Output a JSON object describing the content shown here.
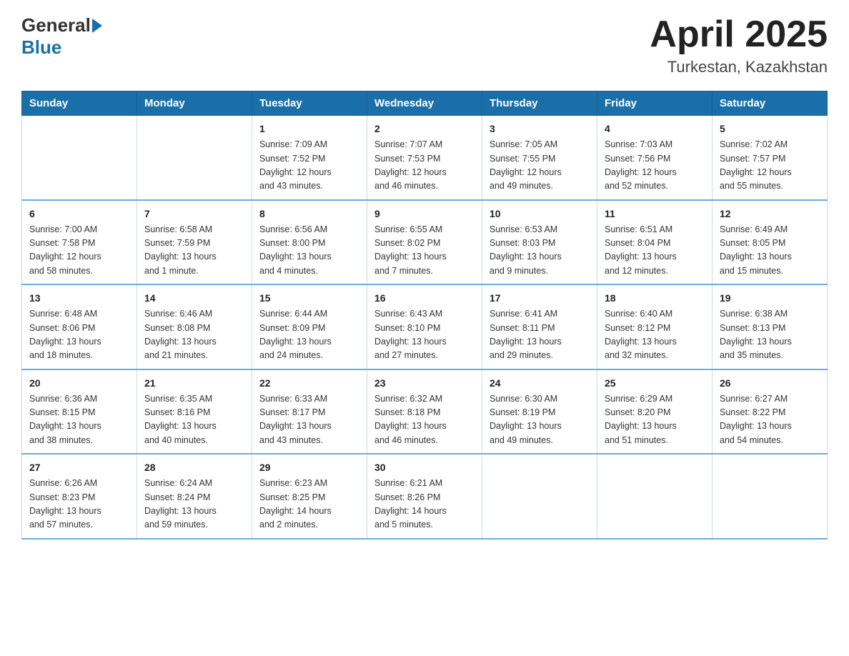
{
  "header": {
    "logo_general": "General",
    "logo_blue": "Blue",
    "title": "April 2025",
    "subtitle": "Turkestan, Kazakhstan"
  },
  "weekdays": [
    "Sunday",
    "Monday",
    "Tuesday",
    "Wednesday",
    "Thursday",
    "Friday",
    "Saturday"
  ],
  "weeks": [
    [
      {
        "day": "",
        "info": ""
      },
      {
        "day": "",
        "info": ""
      },
      {
        "day": "1",
        "info": "Sunrise: 7:09 AM\nSunset: 7:52 PM\nDaylight: 12 hours\nand 43 minutes."
      },
      {
        "day": "2",
        "info": "Sunrise: 7:07 AM\nSunset: 7:53 PM\nDaylight: 12 hours\nand 46 minutes."
      },
      {
        "day": "3",
        "info": "Sunrise: 7:05 AM\nSunset: 7:55 PM\nDaylight: 12 hours\nand 49 minutes."
      },
      {
        "day": "4",
        "info": "Sunrise: 7:03 AM\nSunset: 7:56 PM\nDaylight: 12 hours\nand 52 minutes."
      },
      {
        "day": "5",
        "info": "Sunrise: 7:02 AM\nSunset: 7:57 PM\nDaylight: 12 hours\nand 55 minutes."
      }
    ],
    [
      {
        "day": "6",
        "info": "Sunrise: 7:00 AM\nSunset: 7:58 PM\nDaylight: 12 hours\nand 58 minutes."
      },
      {
        "day": "7",
        "info": "Sunrise: 6:58 AM\nSunset: 7:59 PM\nDaylight: 13 hours\nand 1 minute."
      },
      {
        "day": "8",
        "info": "Sunrise: 6:56 AM\nSunset: 8:00 PM\nDaylight: 13 hours\nand 4 minutes."
      },
      {
        "day": "9",
        "info": "Sunrise: 6:55 AM\nSunset: 8:02 PM\nDaylight: 13 hours\nand 7 minutes."
      },
      {
        "day": "10",
        "info": "Sunrise: 6:53 AM\nSunset: 8:03 PM\nDaylight: 13 hours\nand 9 minutes."
      },
      {
        "day": "11",
        "info": "Sunrise: 6:51 AM\nSunset: 8:04 PM\nDaylight: 13 hours\nand 12 minutes."
      },
      {
        "day": "12",
        "info": "Sunrise: 6:49 AM\nSunset: 8:05 PM\nDaylight: 13 hours\nand 15 minutes."
      }
    ],
    [
      {
        "day": "13",
        "info": "Sunrise: 6:48 AM\nSunset: 8:06 PM\nDaylight: 13 hours\nand 18 minutes."
      },
      {
        "day": "14",
        "info": "Sunrise: 6:46 AM\nSunset: 8:08 PM\nDaylight: 13 hours\nand 21 minutes."
      },
      {
        "day": "15",
        "info": "Sunrise: 6:44 AM\nSunset: 8:09 PM\nDaylight: 13 hours\nand 24 minutes."
      },
      {
        "day": "16",
        "info": "Sunrise: 6:43 AM\nSunset: 8:10 PM\nDaylight: 13 hours\nand 27 minutes."
      },
      {
        "day": "17",
        "info": "Sunrise: 6:41 AM\nSunset: 8:11 PM\nDaylight: 13 hours\nand 29 minutes."
      },
      {
        "day": "18",
        "info": "Sunrise: 6:40 AM\nSunset: 8:12 PM\nDaylight: 13 hours\nand 32 minutes."
      },
      {
        "day": "19",
        "info": "Sunrise: 6:38 AM\nSunset: 8:13 PM\nDaylight: 13 hours\nand 35 minutes."
      }
    ],
    [
      {
        "day": "20",
        "info": "Sunrise: 6:36 AM\nSunset: 8:15 PM\nDaylight: 13 hours\nand 38 minutes."
      },
      {
        "day": "21",
        "info": "Sunrise: 6:35 AM\nSunset: 8:16 PM\nDaylight: 13 hours\nand 40 minutes."
      },
      {
        "day": "22",
        "info": "Sunrise: 6:33 AM\nSunset: 8:17 PM\nDaylight: 13 hours\nand 43 minutes."
      },
      {
        "day": "23",
        "info": "Sunrise: 6:32 AM\nSunset: 8:18 PM\nDaylight: 13 hours\nand 46 minutes."
      },
      {
        "day": "24",
        "info": "Sunrise: 6:30 AM\nSunset: 8:19 PM\nDaylight: 13 hours\nand 49 minutes."
      },
      {
        "day": "25",
        "info": "Sunrise: 6:29 AM\nSunset: 8:20 PM\nDaylight: 13 hours\nand 51 minutes."
      },
      {
        "day": "26",
        "info": "Sunrise: 6:27 AM\nSunset: 8:22 PM\nDaylight: 13 hours\nand 54 minutes."
      }
    ],
    [
      {
        "day": "27",
        "info": "Sunrise: 6:26 AM\nSunset: 8:23 PM\nDaylight: 13 hours\nand 57 minutes."
      },
      {
        "day": "28",
        "info": "Sunrise: 6:24 AM\nSunset: 8:24 PM\nDaylight: 13 hours\nand 59 minutes."
      },
      {
        "day": "29",
        "info": "Sunrise: 6:23 AM\nSunset: 8:25 PM\nDaylight: 14 hours\nand 2 minutes."
      },
      {
        "day": "30",
        "info": "Sunrise: 6:21 AM\nSunset: 8:26 PM\nDaylight: 14 hours\nand 5 minutes."
      },
      {
        "day": "",
        "info": ""
      },
      {
        "day": "",
        "info": ""
      },
      {
        "day": "",
        "info": ""
      }
    ]
  ]
}
